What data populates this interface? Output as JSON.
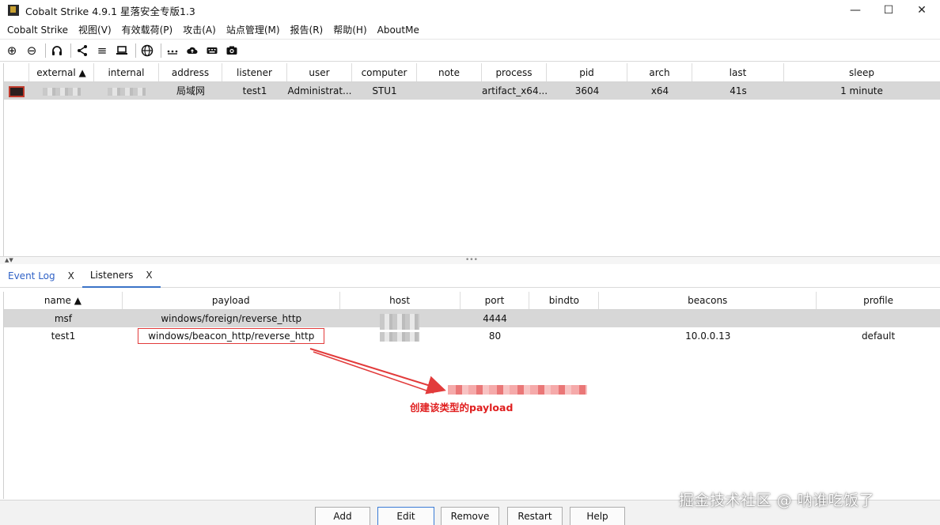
{
  "window": {
    "title": "Cobalt Strike 4.9.1 星落安全专版1.3",
    "controls": {
      "minimize": "—",
      "maximize": "☐",
      "close": "✕"
    }
  },
  "menubar": [
    "Cobalt Strike",
    "视图(V)",
    "有效载荷(P)",
    "攻击(A)",
    "站点管理(M)",
    "报告(R)",
    "帮助(H)",
    "AboutMe"
  ],
  "toolbar": {
    "icons": [
      "plus-circle-icon",
      "minus-circle-icon",
      "headphones-icon",
      "share-icon",
      "list-icon",
      "laptop-icon",
      "globe-icon",
      "dots-icon",
      "cloud-upload-icon",
      "keyboard-icon",
      "camera-icon"
    ]
  },
  "beacons": {
    "columns": [
      "",
      "external ▲",
      "internal",
      "address",
      "listener",
      "user",
      "computer",
      "note",
      "process",
      "pid",
      "arch",
      "last",
      "sleep"
    ],
    "rows": [
      {
        "address": "局域网",
        "listener": "test1",
        "user": "Administrat...",
        "computer": "STU1",
        "note": "",
        "process": "artifact_x64....",
        "pid": "3604",
        "arch": "x64",
        "last": "41s",
        "sleep": "1 minute"
      }
    ]
  },
  "tabs": [
    {
      "label": "Event Log",
      "close": "X"
    },
    {
      "label": "Listeners",
      "close": "X"
    }
  ],
  "listeners": {
    "columns": [
      "name ▲",
      "payload",
      "host",
      "port",
      "bindto",
      "beacons",
      "profile"
    ],
    "rows": [
      {
        "name": "msf",
        "payload": "windows/foreign/reverse_http",
        "host": "",
        "port": "4444",
        "bindto": "",
        "beacons": "",
        "profile": ""
      },
      {
        "name": "test1",
        "payload": "windows/beacon_http/reverse_http",
        "host": "",
        "port": "80",
        "bindto": "",
        "beacons": "10.0.0.13",
        "profile": "default"
      }
    ]
  },
  "annotation": {
    "text": "创建该类型的payload",
    "color": "#e01f1f"
  },
  "buttons": {
    "add": "Add",
    "edit": "Edit",
    "remove": "Remove",
    "restart": "Restart",
    "help": "Help"
  },
  "watermark": "掘金技术社区 @ 呐谁吃饭了",
  "colors": {
    "accent": "#3b73c7",
    "selected_row": "#d7d7d7",
    "annotation": "#e23b3b"
  }
}
